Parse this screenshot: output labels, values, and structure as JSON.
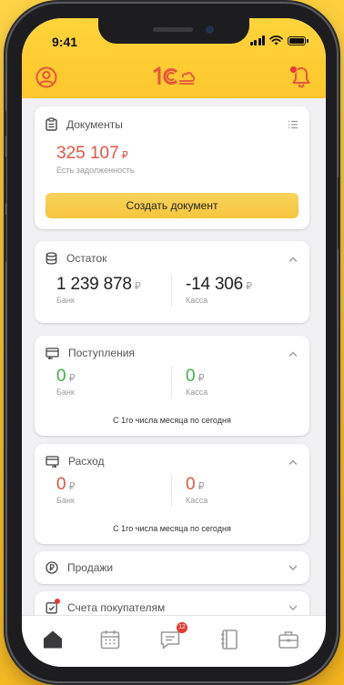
{
  "status_bar": {
    "time": "9:41"
  },
  "header": {
    "logo_text": "1С",
    "accent": "#e8543e"
  },
  "cards": {
    "documents": {
      "title": "Документы",
      "amount": "325 107",
      "currency": "₽",
      "subtitle": "Есть задолженность",
      "button_label": "Создать документ"
    },
    "balance": {
      "title": "Остаток",
      "bank_value": "1 239 878",
      "bank_label": "Банк",
      "cash_value": "-14 306",
      "cash_label": "Касса",
      "currency": "₽"
    },
    "income": {
      "title": "Поступления",
      "bank_value": "0",
      "bank_label": "Банк",
      "cash_value": "0",
      "cash_label": "Касса",
      "currency": "₽",
      "period_note": "С 1го числа месяца по сегодня"
    },
    "expense": {
      "title": "Расход",
      "bank_value": "0",
      "bank_label": "Банк",
      "cash_value": "0",
      "cash_label": "Касса",
      "currency": "₽",
      "period_note": "С 1го числа месяца по сегодня"
    },
    "sales": {
      "title": "Продажи"
    },
    "invoices": {
      "title": "Счета покупателям"
    }
  },
  "tabbar": {
    "items": [
      "home-icon",
      "calendar-icon",
      "chat-icon",
      "notebook-icon",
      "briefcase-icon"
    ],
    "chat_badge": "12"
  },
  "colors": {
    "header_yellow": "#fcc72c",
    "positive": "#42b14b",
    "negative": "#e8543e",
    "button_yellow": "#f6c63c"
  }
}
